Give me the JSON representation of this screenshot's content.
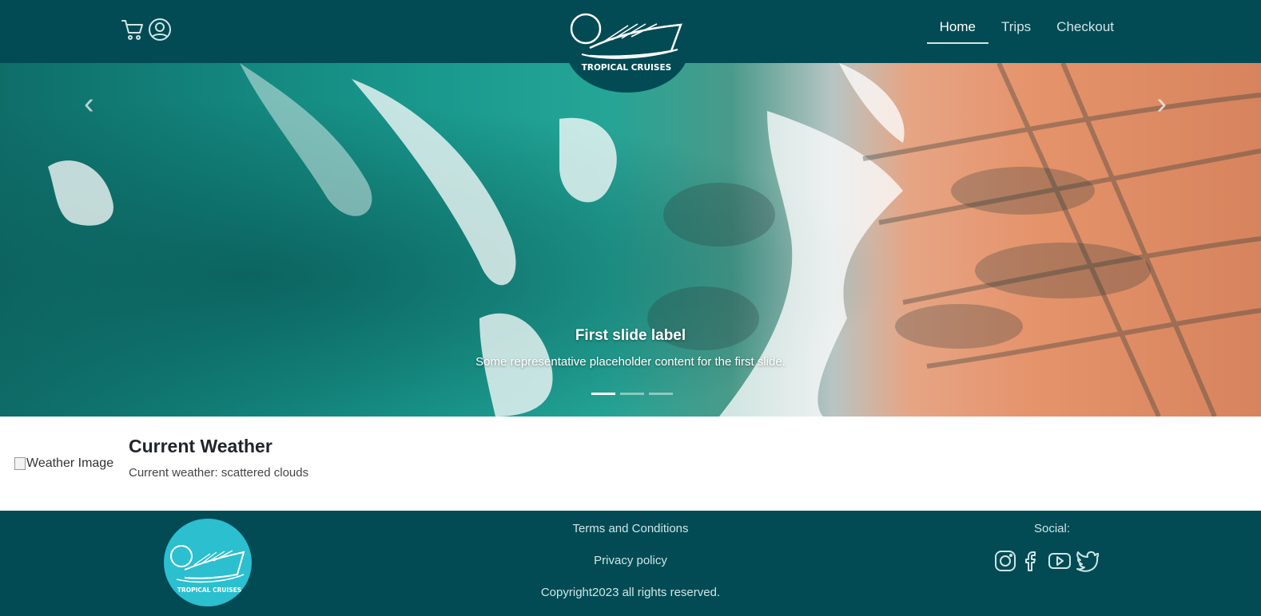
{
  "brand": {
    "logo_text": "TROPICAL CRUISES"
  },
  "nav": {
    "links": [
      {
        "label": "Home",
        "active": true
      },
      {
        "label": "Trips",
        "active": false
      },
      {
        "label": "Checkout",
        "active": false
      }
    ],
    "icons": [
      "cart-icon",
      "user-circle-icon"
    ]
  },
  "carousel": {
    "slide_title": "First slide label",
    "slide_text": "Some representative placeholder content for the first slide.",
    "prev_glyph": "‹",
    "next_glyph": "›",
    "indicator_count": 3,
    "active_index": 0
  },
  "weather": {
    "image_alt": "Weather Image",
    "title": "Current Weather",
    "description": "Current weather: scattered clouds"
  },
  "footer": {
    "terms": "Terms and Conditions",
    "privacy": "Privacy policy",
    "copyright": "Copyright2023 all rights reserved.",
    "social_label": "Social:",
    "social_icons": [
      "instagram-icon",
      "facebook-icon",
      "youtube-icon",
      "twitter-icon"
    ]
  },
  "colors": {
    "nav_bg": "#024b55",
    "footer_bg": "#024b55",
    "footer_logo_bg": "#2bbfd0",
    "link_text": "#cfe6e6"
  }
}
